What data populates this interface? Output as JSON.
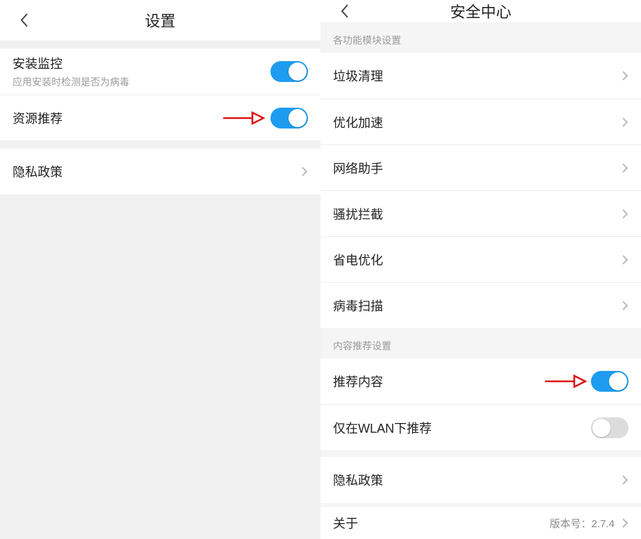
{
  "left": {
    "header": {
      "title": "设置"
    },
    "rows": {
      "install_monitor": {
        "title": "安装监控",
        "sub": "应用安装时检测是否为病毒",
        "toggle": true
      },
      "resource_rec": {
        "title": "资源推荐",
        "toggle": true
      },
      "privacy": {
        "title": "隐私政策"
      }
    }
  },
  "right": {
    "header": {
      "title": "安全中心"
    },
    "groups": {
      "modules_header": "各功能模块设置",
      "content_header": "内容推荐设置",
      "items": {
        "trash": {
          "title": "垃圾清理"
        },
        "boost": {
          "title": "优化加速"
        },
        "network": {
          "title": "网络助手"
        },
        "harass": {
          "title": "骚扰拦截"
        },
        "power": {
          "title": "省电优化"
        },
        "virus": {
          "title": "病毒扫描"
        }
      },
      "content": {
        "recommend": {
          "title": "推荐内容",
          "toggle": true
        },
        "wlan_only": {
          "title": "仅在WLAN下推荐",
          "toggle": false
        }
      },
      "privacy": {
        "title": "隐私政策"
      },
      "about": {
        "title": "关于",
        "meta": "版本号：2.7.4"
      }
    }
  }
}
